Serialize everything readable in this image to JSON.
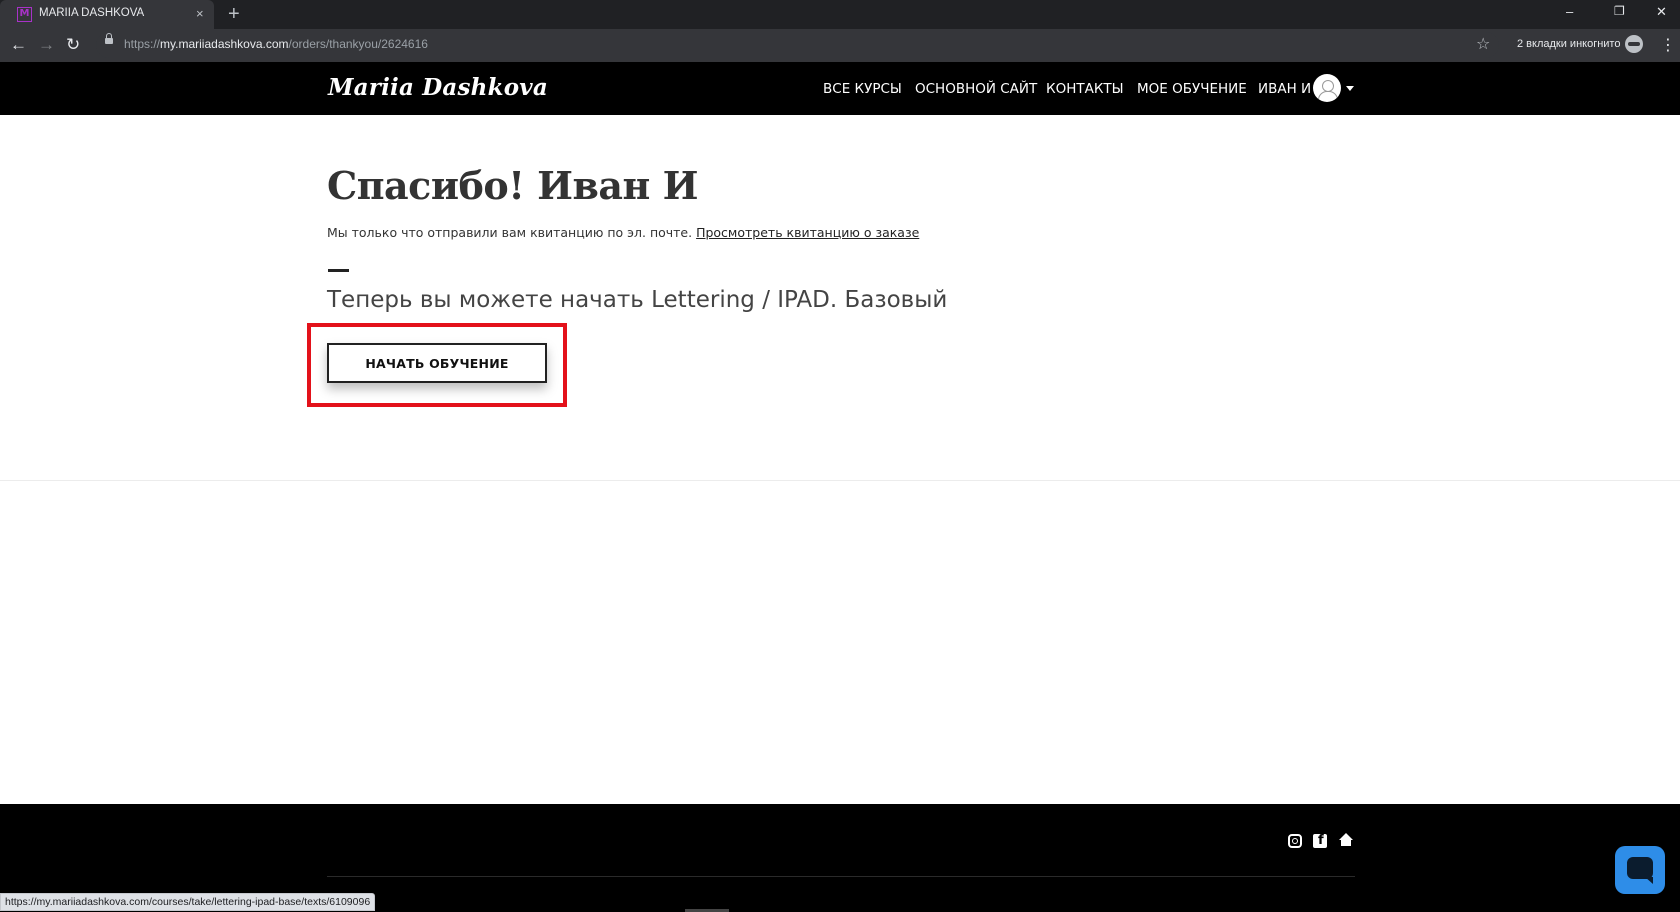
{
  "browser": {
    "tab_title": "MARIIA DASHKOVA",
    "tab_favicon": "M",
    "tab_close": "×",
    "new_tab": "+",
    "url_scheme": "https://",
    "url_host": "my.mariiadashkova.com",
    "url_path": "/orders/thankyou/2624616",
    "incognito_text": "2 вкладки инкогнито",
    "status_url": "https://my.mariiadashkova.com/courses/take/lettering-ipad-base/texts/6109096",
    "icons": {
      "back": "back-arrow-icon",
      "forward": "forward-arrow-icon",
      "reload": "reload-icon",
      "lock": "lock-icon",
      "star": "bookmark-star-icon",
      "menu": "kebab-menu-icon",
      "incognito": "incognito-icon"
    },
    "glyphs": {
      "back": "←",
      "forward": "→",
      "reload": "↻",
      "star": "☆",
      "menu": "⋮",
      "minimize": "–",
      "restore": "❐",
      "close": "✕"
    }
  },
  "header": {
    "logo": "Mariia Dashkova",
    "nav": {
      "all_courses": "ВСЕ КУРСЫ",
      "main_site": "ОСНОВНОЙ САЙТ",
      "contacts": "КОНТАКТЫ",
      "my_learning": "МОЕ ОБУЧЕНИЕ",
      "user_name": "ИВАН И"
    }
  },
  "main": {
    "title": "Спасибо! Иван И",
    "receipt_text": "Мы только что отправили вам квитанцию по эл. почте. ",
    "receipt_link": "Просмотреть квитанцию о заказе",
    "course_text": "Теперь вы можете начать Lettering / IPAD. Базовый",
    "start_button": "НАЧАТЬ ОБУЧЕНИЕ",
    "highlight_color": "#e3111a"
  },
  "footer": {
    "social_icons": [
      "instagram-icon",
      "facebook-icon",
      "home-icon"
    ],
    "chat_color": "#2e8de8"
  }
}
